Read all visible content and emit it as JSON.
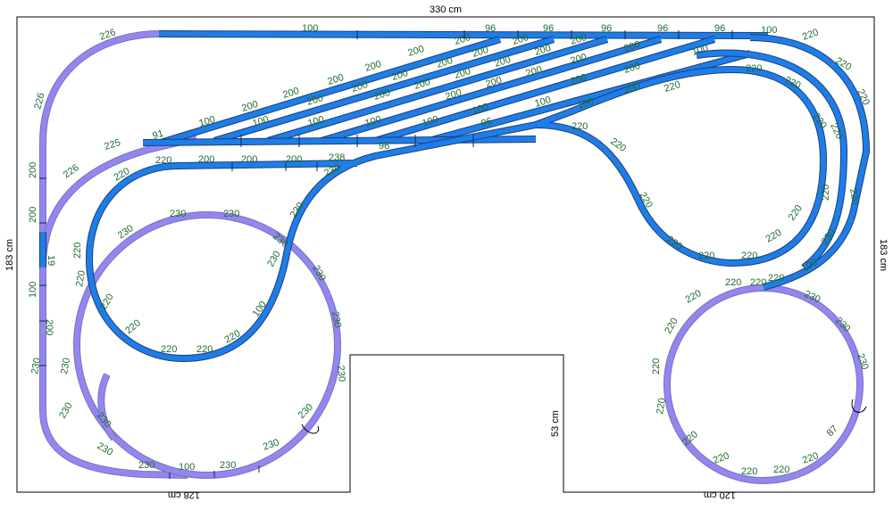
{
  "dimensions": {
    "top_width": "330 cm",
    "left_height": "183 cm",
    "right_height": "183 cm",
    "bottom_left_width": "128 cm",
    "bottom_right_width": "120 cm",
    "cutout_height": "53 cm"
  },
  "colors": {
    "track_main": "#1e7ee8",
    "track_secondary": "#9287ef",
    "label_text": "#1f6b2f",
    "board_outline": "#000000"
  },
  "track_labels": [
    "100",
    "96",
    "96",
    "96",
    "96",
    "96",
    "100",
    "226",
    "226",
    "220",
    "220",
    "220",
    "220",
    "200",
    "200",
    "200",
    "200",
    "200",
    "200",
    "200",
    "200",
    "200",
    "200",
    "200",
    "200",
    "200",
    "200",
    "200",
    "200",
    "200",
    "200",
    "200",
    "200",
    "200",
    "200",
    "200",
    "200",
    "200",
    "200",
    "100",
    "100",
    "100",
    "100",
    "100",
    "100",
    "100",
    "100",
    "100",
    "91",
    "96",
    "96",
    "225",
    "226",
    "220",
    "220",
    "200",
    "200",
    "200",
    "238",
    "230",
    "230",
    "230",
    "230",
    "230",
    "230",
    "200",
    "200",
    "19",
    "100",
    "200",
    "230",
    "230",
    "230",
    "220",
    "220",
    "220",
    "220",
    "220",
    "220",
    "220",
    "100",
    "230",
    "230",
    "230",
    "230",
    "230",
    "230",
    "230",
    "100",
    "230",
    "230",
    "230",
    "220",
    "220",
    "220",
    "220",
    "220",
    "220",
    "220",
    "220",
    "220",
    "220",
    "220",
    "220",
    "220",
    "220",
    "220",
    "220",
    "220",
    "220",
    "220",
    "220",
    "220",
    "220",
    "220",
    "220",
    "87",
    "230",
    "230",
    "230",
    "100",
    "230",
    "220",
    "220"
  ]
}
